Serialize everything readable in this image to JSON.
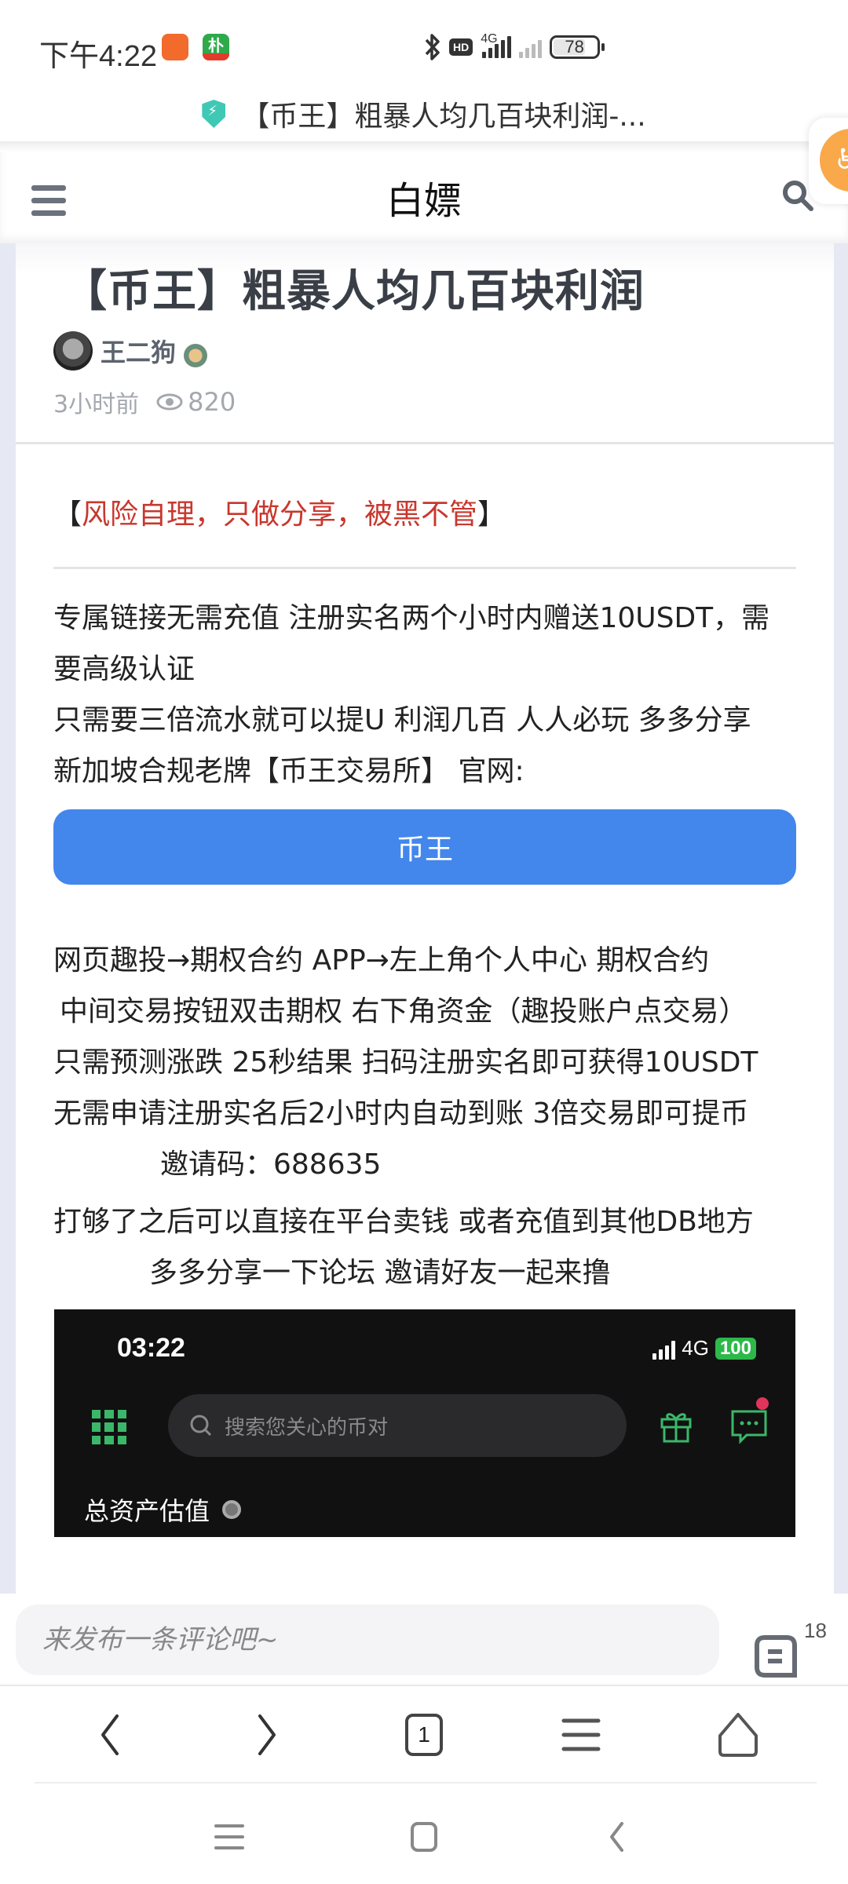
{
  "status_bar": {
    "time": "下午4:22",
    "notification_apps": [
      "xiaomi-store-app",
      "pu-app-618"
    ],
    "app2_glyph": "朴",
    "network": "4G",
    "hd_label": "HD",
    "battery": "78"
  },
  "browser": {
    "page_title": "【币王】粗暴人均几百块利润-...",
    "security_icon": "shield-bolt-icon"
  },
  "site": {
    "title": "白嫖",
    "menu_icon": "hamburger-icon",
    "search_icon": "search-icon",
    "float_icon": "accessibility-icon"
  },
  "post": {
    "title": "【币王】粗暴人均几百块利润",
    "author": "王二狗",
    "time_ago": "3小时前",
    "views": "820",
    "risk_open": "【",
    "risk_text": "风险自理，只做分享，被黑不管",
    "risk_close": "】",
    "para1": [
      "专属链接无需充值 注册实名两个小时内赠送10USDT，需要高级认证",
      "只需要三倍流水就可以提U 利润几百 人人必玩 多多分享",
      "新加坡合规老牌【币王交易所】 官网:"
    ],
    "cta_label": "币王",
    "para2": [
      "网页趣投→期权合约 APP→左上角个人中心 期权合约",
      "中间交易按钮双击期权 右下角资金（趣投账户点交易）",
      "只需预测涨跌 25秒结果 扫码注册实名即可获得10USDT",
      "无需申请注册实名后2小时内自动到账 3倍交易即可提币",
      "邀请码：688635",
      "打够了之后可以直接在平台卖钱 或者充值到其他DB地方",
      "多多分享一下论坛 邀请好友一起来撸"
    ],
    "embedded_screenshot": {
      "time": "03:22",
      "network": "4G",
      "battery": "100",
      "search_placeholder": "搜索您关心的币对",
      "total_assets_label": "总资产估值"
    }
  },
  "comment_bar": {
    "placeholder": "来发布一条评论吧~",
    "comment_count": "18"
  },
  "toolbar": {
    "tab_count": "1"
  }
}
